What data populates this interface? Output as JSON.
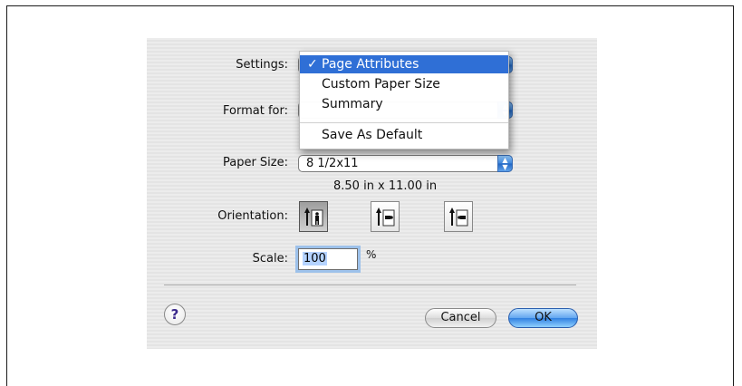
{
  "settings": {
    "label": "Settings:",
    "menu": {
      "items": [
        {
          "label": "Page Attributes",
          "checked": true,
          "check": "✓"
        },
        {
          "label": "Custom Paper Size"
        },
        {
          "label": "Summary"
        },
        {
          "label": "Save As Default"
        }
      ]
    }
  },
  "format_for": {
    "label": "Format for:",
    "value": ""
  },
  "paper_size": {
    "label": "Paper Size:",
    "value": "8 1/2x11",
    "dimensions": "8.50 in x 11.00 in"
  },
  "orientation": {
    "label": "Orientation:",
    "options": [
      {
        "name": "portrait",
        "selected": true
      },
      {
        "name": "landscape-left",
        "selected": false
      },
      {
        "name": "landscape-right",
        "selected": false
      }
    ]
  },
  "scale": {
    "label": "Scale:",
    "value": "100",
    "unit": "%"
  },
  "buttons": {
    "help": "?",
    "cancel": "Cancel",
    "ok": "OK"
  },
  "colors": {
    "accent": "#2f6fd6",
    "default_button": "#3a8be8"
  },
  "icons": [
    "popup-stepper-icon",
    "portrait-orientation-icon",
    "landscape-left-orientation-icon",
    "landscape-right-orientation-icon",
    "help-icon",
    "checkmark-icon"
  ]
}
